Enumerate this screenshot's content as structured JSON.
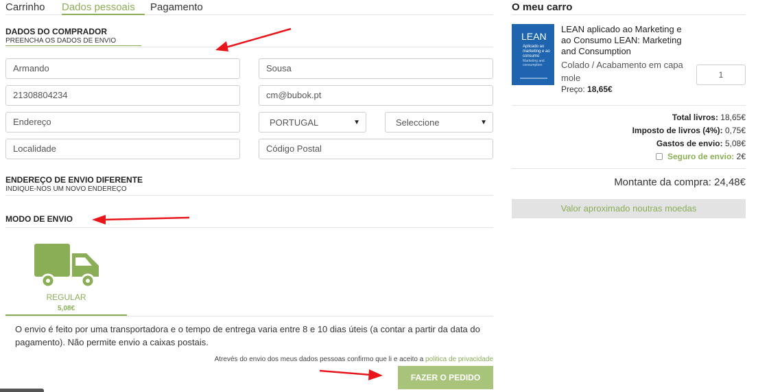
{
  "tabs": [
    {
      "label": "Carrinho"
    },
    {
      "label": "Dados pessoais"
    },
    {
      "label": "Pagamento"
    }
  ],
  "buyer_section": {
    "title": "DADOS DO COMPRADOR",
    "subtitle": "PREENCHA OS DADOS DE ENVIO"
  },
  "form": {
    "first_name": "Armando",
    "last_name": "Sousa",
    "phone": "21308804234",
    "email": "cm@bubok.pt",
    "address_placeholder": "Endereço",
    "country": "PORTUGAL",
    "region": "Seleccione",
    "city_placeholder": "Localidade",
    "postal_placeholder": "Código Postal"
  },
  "alt_address": {
    "title": "ENDEREÇO DE ENVIO DIFERENTE",
    "subtitle": "INDIQUE-NOS UM NOVO ENDEREÇO"
  },
  "shipping": {
    "title": "MODO DE ENVIO",
    "option_label": "REGULAR",
    "option_price": "5,08€",
    "description": "O envio é feito por uma transportadora e o tempo de entrega varia entre 8 e 10 dias úteis (a contar a partir da data do pagamento). Não permite envio a caixas postais."
  },
  "consent": {
    "text": "Atrevés do envio dos meus dados pessoas confirmo que li e aceito a",
    "link": "politica de privacidade"
  },
  "order_button": "FAZER O PEDIDO",
  "cart": {
    "title": "O meu carro",
    "cover": {
      "line1": "LEAN",
      "line2": "Aplicado ao marketing e ao consumo",
      "line3": "Marketing and consumption"
    },
    "book_title": "LEAN aplicado ao Marketing e ao Consumo LEAN: Marketing and Consumption",
    "book_finish": "Colado / Acabamento em capa mole",
    "price_label": "Preço:",
    "price_value": "18,65€",
    "quantity": "1",
    "total_books_label": "Total livros:",
    "total_books_value": "18,65€",
    "tax_label": "Imposto de livros (4%):",
    "tax_value": "0,75€",
    "shipping_label": "Gastos de envio:",
    "shipping_value": "5,08€",
    "insurance_label": "Seguro de envio:",
    "insurance_value": "2€",
    "grand_total_label": "Montante da compra:",
    "grand_total_value": "24,48€",
    "currency_button": "Valor aproximado noutras moedas"
  },
  "colors": {
    "accent": "#8aae56",
    "button": "#a8c47a",
    "annotation_arrow": "#e8151b"
  }
}
